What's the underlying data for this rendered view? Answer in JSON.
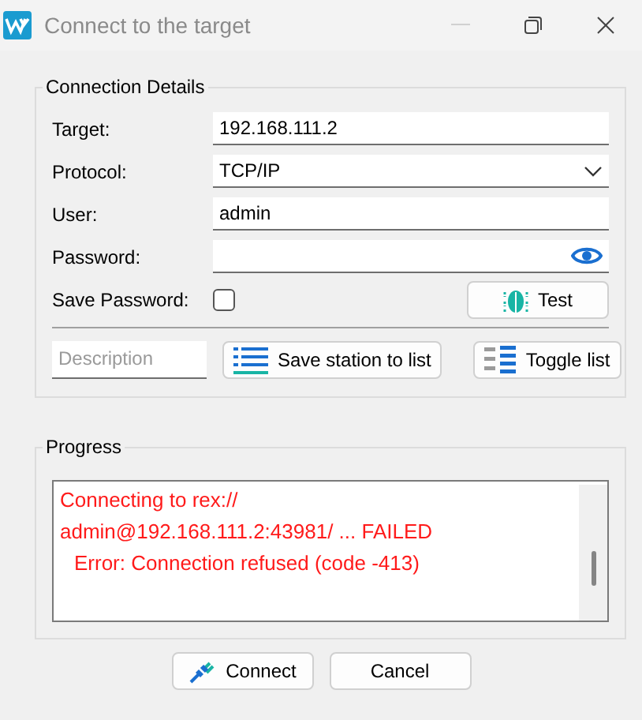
{
  "window": {
    "title": "Connect to the target"
  },
  "connection_details": {
    "title": "Connection Details",
    "fields": [
      {
        "kind": "text",
        "label": "Target:",
        "value": "192.168.111.2"
      },
      {
        "kind": "select",
        "label": "Protocol:",
        "value": "TCP/IP"
      },
      {
        "kind": "text",
        "label": "User:",
        "value": "admin"
      },
      {
        "kind": "password",
        "label": "Password:"
      }
    ],
    "save_password": {
      "label": "Save Password:",
      "checked": false
    },
    "test_button": "Test",
    "description": {
      "placeholder": "Description"
    },
    "save_station_button": "Save station to list",
    "toggle_list_button": "Toggle list"
  },
  "progress": {
    "title": "Progress",
    "log": [
      {
        "kind": "message",
        "text": "Connecting to rex://"
      },
      {
        "kind": "message",
        "text": "admin@192.168.111.2:43981/  ...  FAILED"
      },
      {
        "kind": "detail",
        "text": "Error: Connection refused (code -413)"
      }
    ]
  },
  "buttons": {
    "connect": "Connect",
    "cancel": "Cancel"
  }
}
